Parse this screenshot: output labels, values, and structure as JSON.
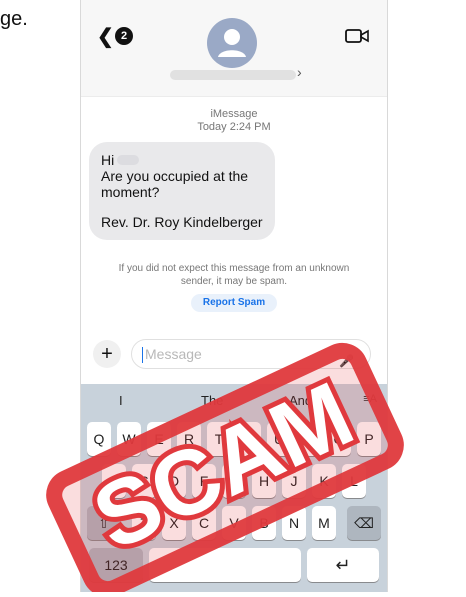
{
  "page": {
    "left_fragment": "ge."
  },
  "header": {
    "unread_badge": "2",
    "back_icon": "chevron-left-icon",
    "avatar_icon": "person-avatar-icon",
    "video_icon": "video-camera-icon"
  },
  "conversation": {
    "service": "iMessage",
    "timestamp": "Today 2:24 PM",
    "bubble": {
      "line1": "Hi",
      "line2": "Are you occupied at the",
      "line3": "moment?",
      "line4": "Rev. Dr. Roy Kindelberger"
    },
    "spam_note_1": "If you did not expect this message from an unknown",
    "spam_note_2": "sender, it may be spam.",
    "report_label": "Report Spam"
  },
  "composer": {
    "plus_label": "+",
    "placeholder": "Message",
    "mic_icon": "microphone-icon"
  },
  "keyboard": {
    "predictions": [
      "I",
      "The",
      "And"
    ],
    "emoji_key": "≡A",
    "row1": [
      "Q",
      "W",
      "E",
      "R",
      "T",
      "Y",
      "U",
      "I",
      "O",
      "P"
    ],
    "row2": [
      "A",
      "S",
      "D",
      "F",
      "G",
      "H",
      "J",
      "K",
      "L"
    ],
    "row3": [
      "Z",
      "X",
      "C",
      "V",
      "B",
      "N",
      "M"
    ],
    "shift_label": "⇧",
    "delete_label": "⌫",
    "num_label": "123",
    "return_label": "↵"
  },
  "stamp": {
    "text": "SCAM",
    "color": "#e0393d"
  }
}
